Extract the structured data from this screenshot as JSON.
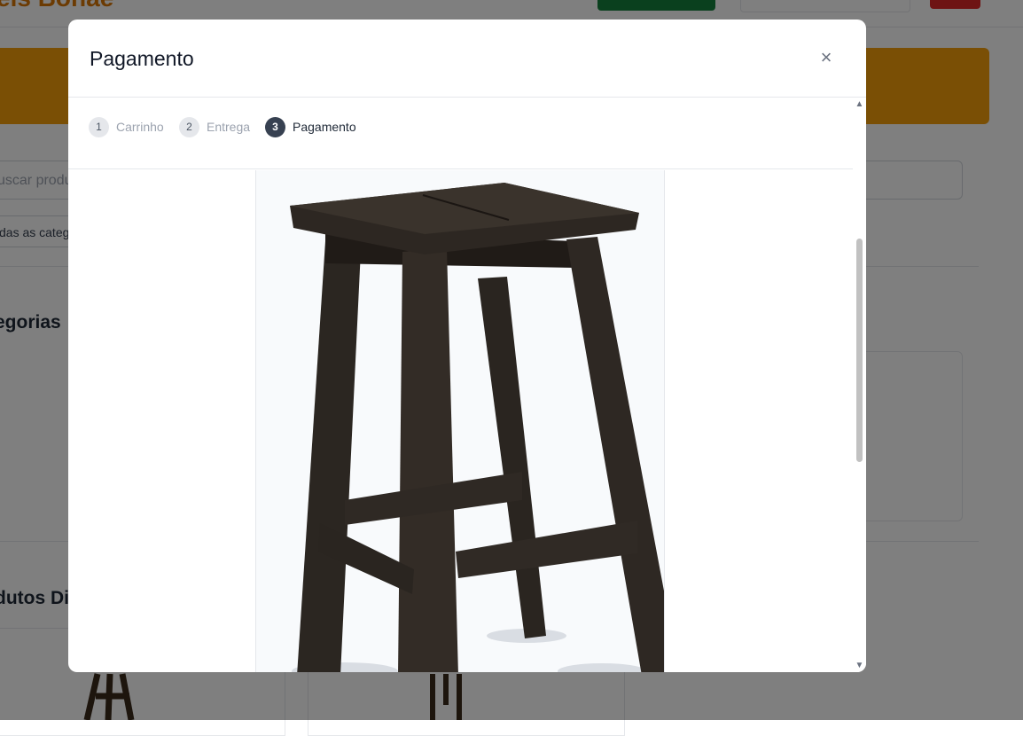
{
  "background_page": {
    "brand": "eis Bonaé",
    "search_placeholder": "uscar produ",
    "category_select": "das as categ",
    "section_categories": "egorias",
    "section_products": "dutos Di"
  },
  "modal": {
    "title": "Pagamento",
    "close_label": "×",
    "steps": [
      {
        "number": "1",
        "label": "Carrinho",
        "state": "done"
      },
      {
        "number": "2",
        "label": "Entrega",
        "state": "done"
      },
      {
        "number": "3",
        "label": "Pagamento",
        "state": "active"
      }
    ]
  },
  "scrollbar": {
    "up_icon": "▲",
    "down_icon": "▼"
  },
  "colors": {
    "overlay": "#000000",
    "banner": "#f59e0b",
    "active_step": "#374151",
    "inactive_step": "#e5e7eb"
  }
}
